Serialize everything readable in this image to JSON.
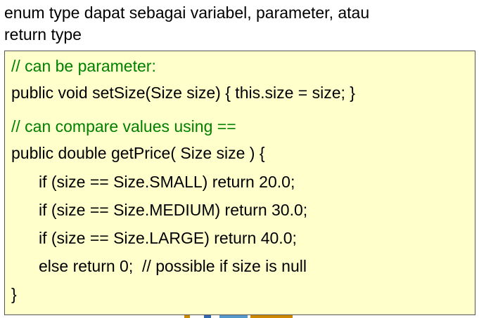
{
  "intro": {
    "line1": "enum type dapat sebagai variabel, parameter, atau",
    "line2": "return type"
  },
  "code": {
    "lines": [
      {
        "text": "// can be parameter:",
        "kind": "comment"
      },
      {
        "text": "public void setSize(Size size) { this.size = size; }",
        "kind": "code"
      },
      {
        "text": "// can compare values using ==",
        "kind": "comment"
      },
      {
        "text": "public double getPrice( Size size ) {",
        "kind": "code"
      },
      {
        "text": "if (size == Size.SMALL) return 20.0;",
        "kind": "code"
      },
      {
        "text": "if (size == Size.MEDIUM) return 30.0;",
        "kind": "code"
      },
      {
        "text": "if (size == Size.LARGE) return 40.0;",
        "kind": "code"
      },
      {
        "text": "else return 0;  // possible if size is null",
        "kind": "code"
      },
      {
        "text": "}",
        "kind": "code"
      }
    ]
  },
  "colors": {
    "comment": "#008000",
    "code_background": "#ffffcc",
    "border": "#555555"
  }
}
